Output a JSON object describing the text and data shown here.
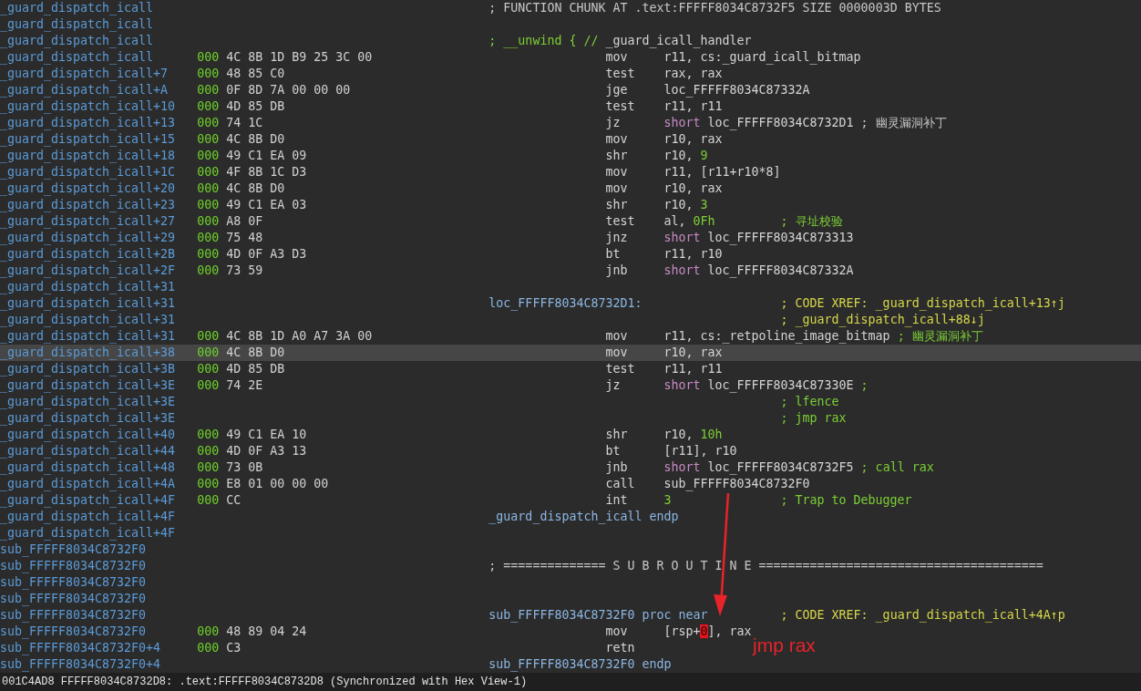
{
  "listing": {
    "rows": [
      {
        "address": "_guard_dispatch_icall",
        "current": false,
        "code": {
          "kind": "line",
          "lead": [
            {
              "text": "; FUNCTION CHUNK AT .text:FFFFF8034C8732F5 SIZE 0000003D BYTES",
              "kind": "gray"
            }
          ]
        }
      },
      {
        "address": "_guard_dispatch_icall",
        "current": false,
        "code": {
          "kind": "blank"
        }
      },
      {
        "address": "_guard_dispatch_icall",
        "current": false,
        "code": {
          "kind": "line",
          "lead": [
            {
              "text": "; __unwind { // ",
              "kind": "cmt"
            },
            {
              "text": "_guard_icall_handler",
              "kind": "plain"
            }
          ]
        }
      },
      {
        "address": "_guard_dispatch_icall",
        "sp": "000",
        "bytes": "4C 8B 1D B9 25 3C 00",
        "current": false,
        "code": {
          "kind": "insn",
          "mnemonic": "mov",
          "operands": [
            {
              "text": "r11, cs:_guard_icall_bitmap",
              "kind": "plain"
            }
          ]
        }
      },
      {
        "address": "_guard_dispatch_icall+7",
        "sp": "000",
        "bytes": "48 85 C0",
        "current": false,
        "code": {
          "kind": "insn",
          "mnemonic": "test",
          "operands": [
            {
              "text": "rax, rax",
              "kind": "plain"
            }
          ]
        }
      },
      {
        "address": "_guard_dispatch_icall+A",
        "sp": "000",
        "bytes": "0F 8D 7A 00 00 00",
        "current": false,
        "code": {
          "kind": "insn",
          "mnemonic": "jge",
          "operands": [
            {
              "text": "loc_FFFFF8034C87332A",
              "kind": "plain"
            }
          ]
        }
      },
      {
        "address": "_guard_dispatch_icall+10",
        "sp": "000",
        "bytes": "4D 85 DB",
        "current": false,
        "code": {
          "kind": "insn",
          "mnemonic": "test",
          "operands": [
            {
              "text": "r11, r11",
              "kind": "plain"
            }
          ]
        }
      },
      {
        "address": "_guard_dispatch_icall+13",
        "sp": "000",
        "bytes": "74 1C",
        "current": false,
        "code": {
          "kind": "insn",
          "mnemonic": "jz",
          "operands": [
            {
              "text": "short",
              "kind": "kw"
            },
            {
              "text": " loc_FFFFF8034C8732D1",
              "kind": "plain"
            }
          ],
          "comment": [
            {
              "text": "; 幽灵漏洞补丁",
              "kind": "gray"
            }
          ]
        }
      },
      {
        "address": "_guard_dispatch_icall+15",
        "sp": "000",
        "bytes": "4C 8B D0",
        "current": false,
        "code": {
          "kind": "insn",
          "mnemonic": "mov",
          "operands": [
            {
              "text": "r10, rax",
              "kind": "plain"
            }
          ]
        }
      },
      {
        "address": "_guard_dispatch_icall+18",
        "sp": "000",
        "bytes": "49 C1 EA 09",
        "current": false,
        "code": {
          "kind": "insn",
          "mnemonic": "shr",
          "operands": [
            {
              "text": "r10, ",
              "kind": "plain"
            },
            {
              "text": "9",
              "kind": "num"
            }
          ]
        }
      },
      {
        "address": "_guard_dispatch_icall+1C",
        "sp": "000",
        "bytes": "4F 8B 1C D3",
        "current": false,
        "code": {
          "kind": "insn",
          "mnemonic": "mov",
          "operands": [
            {
              "text": "r11, [r11+r10*8]",
              "kind": "plain"
            }
          ]
        }
      },
      {
        "address": "_guard_dispatch_icall+20",
        "sp": "000",
        "bytes": "4C 8B D0",
        "current": false,
        "code": {
          "kind": "insn",
          "mnemonic": "mov",
          "operands": [
            {
              "text": "r10, rax",
              "kind": "plain"
            }
          ]
        }
      },
      {
        "address": "_guard_dispatch_icall+23",
        "sp": "000",
        "bytes": "49 C1 EA 03",
        "current": false,
        "code": {
          "kind": "insn",
          "mnemonic": "shr",
          "operands": [
            {
              "text": "r10, ",
              "kind": "plain"
            },
            {
              "text": "3",
              "kind": "num"
            }
          ]
        }
      },
      {
        "address": "_guard_dispatch_icall+27",
        "sp": "000",
        "bytes": "A8 0F",
        "current": false,
        "code": {
          "kind": "insn",
          "mnemonic": "test",
          "operands": [
            {
              "text": "al, ",
              "kind": "plain"
            },
            {
              "text": "0Fh",
              "kind": "num"
            }
          ],
          "comment": [
            {
              "text": "; 寻址校验",
              "kind": "cmt"
            }
          ]
        }
      },
      {
        "address": "_guard_dispatch_icall+29",
        "sp": "000",
        "bytes": "75 48",
        "current": false,
        "code": {
          "kind": "insn",
          "mnemonic": "jnz",
          "operands": [
            {
              "text": "short",
              "kind": "kw"
            },
            {
              "text": " loc_FFFFF8034C873313",
              "kind": "plain"
            }
          ]
        }
      },
      {
        "address": "_guard_dispatch_icall+2B",
        "sp": "000",
        "bytes": "4D 0F A3 D3",
        "current": false,
        "code": {
          "kind": "insn",
          "mnemonic": "bt",
          "operands": [
            {
              "text": "r11, r10",
              "kind": "plain"
            }
          ]
        }
      },
      {
        "address": "_guard_dispatch_icall+2F",
        "sp": "000",
        "bytes": "73 59",
        "current": false,
        "code": {
          "kind": "insn",
          "mnemonic": "jnb",
          "operands": [
            {
              "text": "short",
              "kind": "kw"
            },
            {
              "text": " loc_FFFFF8034C87332A",
              "kind": "plain"
            }
          ]
        }
      },
      {
        "address": "_guard_dispatch_icall+31",
        "current": false,
        "code": {
          "kind": "blank"
        }
      },
      {
        "address": "_guard_dispatch_icall+31",
        "current": false,
        "code": {
          "kind": "line",
          "lead": [
            {
              "text": "loc_FFFFF8034C8732D1:",
              "kind": "label"
            }
          ],
          "comment": [
            {
              "text": "; CODE XREF: _guard_dispatch_icall+13↑j",
              "kind": "xref"
            }
          ]
        }
      },
      {
        "address": "_guard_dispatch_icall+31",
        "current": false,
        "code": {
          "kind": "line",
          "comment": [
            {
              "text": "; _guard_dispatch_icall+88↓j",
              "kind": "xref"
            }
          ]
        }
      },
      {
        "address": "_guard_dispatch_icall+31",
        "sp": "000",
        "bytes": "4C 8B 1D A0 A7 3A 00",
        "current": false,
        "code": {
          "kind": "insn",
          "mnemonic": "mov",
          "operands": [
            {
              "text": "r11, cs:_retpoline_image_bitmap",
              "kind": "plain"
            }
          ],
          "comment": [
            {
              "text": "; 幽灵漏洞补丁",
              "kind": "cmt"
            }
          ]
        }
      },
      {
        "address": "_guard_dispatch_icall+38",
        "sp": "000",
        "bytes": "4C 8B D0",
        "current": true,
        "code": {
          "kind": "insn",
          "mnemonic": "mov",
          "operands": [
            {
              "text": "r10, rax",
              "kind": "plain"
            }
          ]
        }
      },
      {
        "address": "_guard_dispatch_icall+3B",
        "sp": "000",
        "bytes": "4D 85 DB",
        "current": false,
        "code": {
          "kind": "insn",
          "mnemonic": "test",
          "operands": [
            {
              "text": "r11, r11",
              "kind": "plain"
            }
          ]
        }
      },
      {
        "address": "_guard_dispatch_icall+3E",
        "sp": "000",
        "bytes": "74 2E",
        "current": false,
        "code": {
          "kind": "insn",
          "mnemonic": "jz",
          "operands": [
            {
              "text": "short",
              "kind": "kw"
            },
            {
              "text": " loc_FFFFF8034C87330E",
              "kind": "plain"
            }
          ],
          "comment": [
            {
              "text": ";",
              "kind": "cmt"
            }
          ]
        }
      },
      {
        "address": "_guard_dispatch_icall+3E",
        "current": false,
        "code": {
          "kind": "line",
          "comment": [
            {
              "text": "; lfence",
              "kind": "cmt"
            }
          ]
        }
      },
      {
        "address": "_guard_dispatch_icall+3E",
        "current": false,
        "code": {
          "kind": "line",
          "comment": [
            {
              "text": "; jmp rax",
              "kind": "cmt"
            }
          ]
        }
      },
      {
        "address": "_guard_dispatch_icall+40",
        "sp": "000",
        "bytes": "49 C1 EA 10",
        "current": false,
        "code": {
          "kind": "insn",
          "mnemonic": "shr",
          "operands": [
            {
              "text": "r10, ",
              "kind": "plain"
            },
            {
              "text": "10h",
              "kind": "num"
            }
          ]
        }
      },
      {
        "address": "_guard_dispatch_icall+44",
        "sp": "000",
        "bytes": "4D 0F A3 13",
        "current": false,
        "code": {
          "kind": "insn",
          "mnemonic": "bt",
          "operands": [
            {
              "text": "[r11], r10",
              "kind": "plain"
            }
          ]
        }
      },
      {
        "address": "_guard_dispatch_icall+48",
        "sp": "000",
        "bytes": "73 0B",
        "current": false,
        "code": {
          "kind": "insn",
          "mnemonic": "jnb",
          "operands": [
            {
              "text": "short",
              "kind": "kw"
            },
            {
              "text": " loc_FFFFF8034C8732F5",
              "kind": "plain"
            }
          ],
          "comment": [
            {
              "text": "; call rax",
              "kind": "cmt"
            }
          ]
        }
      },
      {
        "address": "_guard_dispatch_icall+4A",
        "sp": "000",
        "bytes": "E8 01 00 00 00",
        "current": false,
        "code": {
          "kind": "insn",
          "mnemonic": "call",
          "operands": [
            {
              "text": "sub_FFFFF8034C8732F0",
              "kind": "plain"
            }
          ]
        }
      },
      {
        "address": "_guard_dispatch_icall+4F",
        "sp": "000",
        "bytes": "CC",
        "current": false,
        "code": {
          "kind": "insn",
          "mnemonic": "int",
          "operands": [
            {
              "text": "3",
              "kind": "num"
            }
          ],
          "comment": [
            {
              "text": "; Trap to Debugger",
              "kind": "cmt"
            }
          ]
        }
      },
      {
        "address": "_guard_dispatch_icall+4F",
        "current": false,
        "code": {
          "kind": "line",
          "lead": [
            {
              "text": "_guard_dispatch_icall endp",
              "kind": "label"
            }
          ]
        }
      },
      {
        "address": "_guard_dispatch_icall+4F",
        "current": false,
        "code": {
          "kind": "blank"
        }
      },
      {
        "address": "sub_FFFFF8034C8732F0",
        "current": false,
        "code": {
          "kind": "blank"
        }
      },
      {
        "address": "sub_FFFFF8034C8732F0",
        "current": false,
        "code": {
          "kind": "line",
          "lead": [
            {
              "text": "; ============== S U B R O U T I N E =======================================",
              "kind": "gray"
            }
          ]
        }
      },
      {
        "address": "sub_FFFFF8034C8732F0",
        "current": false,
        "code": {
          "kind": "blank"
        }
      },
      {
        "address": "sub_FFFFF8034C8732F0",
        "current": false,
        "code": {
          "kind": "blank"
        }
      },
      {
        "address": "sub_FFFFF8034C8732F0",
        "current": false,
        "code": {
          "kind": "line",
          "lead": [
            {
              "text": "sub_FFFFF8034C8732F0 proc near",
              "kind": "label"
            }
          ],
          "comment": [
            {
              "text": "; CODE XREF: _guard_dispatch_icall+4A↑p",
              "kind": "xref"
            }
          ]
        }
      },
      {
        "address": "sub_FFFFF8034C8732F0",
        "sp": "000",
        "bytes": "48 89 04 24",
        "current": false,
        "code": {
          "kind": "insn",
          "mnemonic": "mov",
          "operands": [
            {
              "text": "[rsp+",
              "kind": "plain"
            },
            {
              "text": "0",
              "kind": "cursor"
            },
            {
              "text": "], rax",
              "kind": "plain"
            }
          ]
        }
      },
      {
        "address": "sub_FFFFF8034C8732F0+4",
        "sp": "000",
        "bytes": "C3",
        "current": false,
        "code": {
          "kind": "insn",
          "mnemonic": "retn"
        }
      },
      {
        "address": "sub_FFFFF8034C8732F0+4",
        "current": false,
        "code": {
          "kind": "line",
          "lead": [
            {
              "text": "sub_FFFFF8034C8732F0 endp",
              "kind": "label"
            }
          ]
        }
      }
    ]
  },
  "annotation": {
    "text": "jmp rax"
  },
  "status_bar": {
    "text": "001C4AD8 FFFFF8034C8732D8: .text:FFFFF8034C8732D8 (Synchronized with Hex View-1)"
  }
}
